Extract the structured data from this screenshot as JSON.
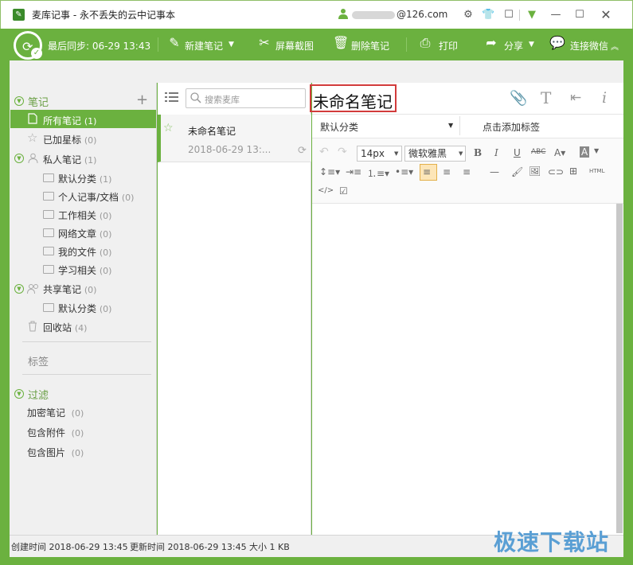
{
  "window": {
    "title": "麦库记事 - 永不丢失的云中记事本",
    "account": "@126.com"
  },
  "toolbar": {
    "last_sync": "最后同步: 06-29 13:43",
    "new_note": "新建笔记",
    "screenshot": "屏幕截图",
    "delete_note": "删除笔记",
    "print": "打印",
    "share": "分享",
    "wechat": "连接微信"
  },
  "sidebar": {
    "notes_header": "笔记",
    "items": [
      {
        "label": "所有笔记",
        "count": "(1)"
      },
      {
        "label": "已加星标",
        "count": "(0)"
      },
      {
        "label": "私人笔记",
        "count": "(1)"
      },
      {
        "label": "默认分类",
        "count": "(1)"
      },
      {
        "label": "个人记事/文档",
        "count": "(0)"
      },
      {
        "label": "工作相关",
        "count": "(0)"
      },
      {
        "label": "网络文章",
        "count": "(0)"
      },
      {
        "label": "我的文件",
        "count": "(0)"
      },
      {
        "label": "学习相关",
        "count": "(0)"
      },
      {
        "label": "共享笔记",
        "count": "(0)"
      },
      {
        "label": "默认分类",
        "count": "(0)"
      },
      {
        "label": "回收站",
        "count": "(4)"
      }
    ],
    "tags_header": "标签",
    "filter_header": "过滤",
    "filters": [
      {
        "label": "加密笔记",
        "count": "(0)"
      },
      {
        "label": "包含附件",
        "count": "(0)"
      },
      {
        "label": "包含图片",
        "count": "(0)"
      }
    ]
  },
  "notelist": {
    "search_placeholder": "搜索麦库",
    "notes": [
      {
        "title": "未命名笔记",
        "date": "2018-06-29 13:..."
      }
    ]
  },
  "editor": {
    "title": "未命名笔记",
    "category": "默认分类",
    "add_tag": "点击添加标签",
    "font_size": "14px",
    "font_family": "微软雅黑",
    "html_label": "HTML",
    "code_label": "</>"
  },
  "status": {
    "created": "创建时间 2018-06-29 13:45",
    "updated": "更新时间 2018-06-29 13:45",
    "size": "大小 1 KB"
  },
  "watermark": "极速下载站",
  "colors": {
    "accent": "#6bb13f",
    "highlight_box": "#d23b3b"
  }
}
